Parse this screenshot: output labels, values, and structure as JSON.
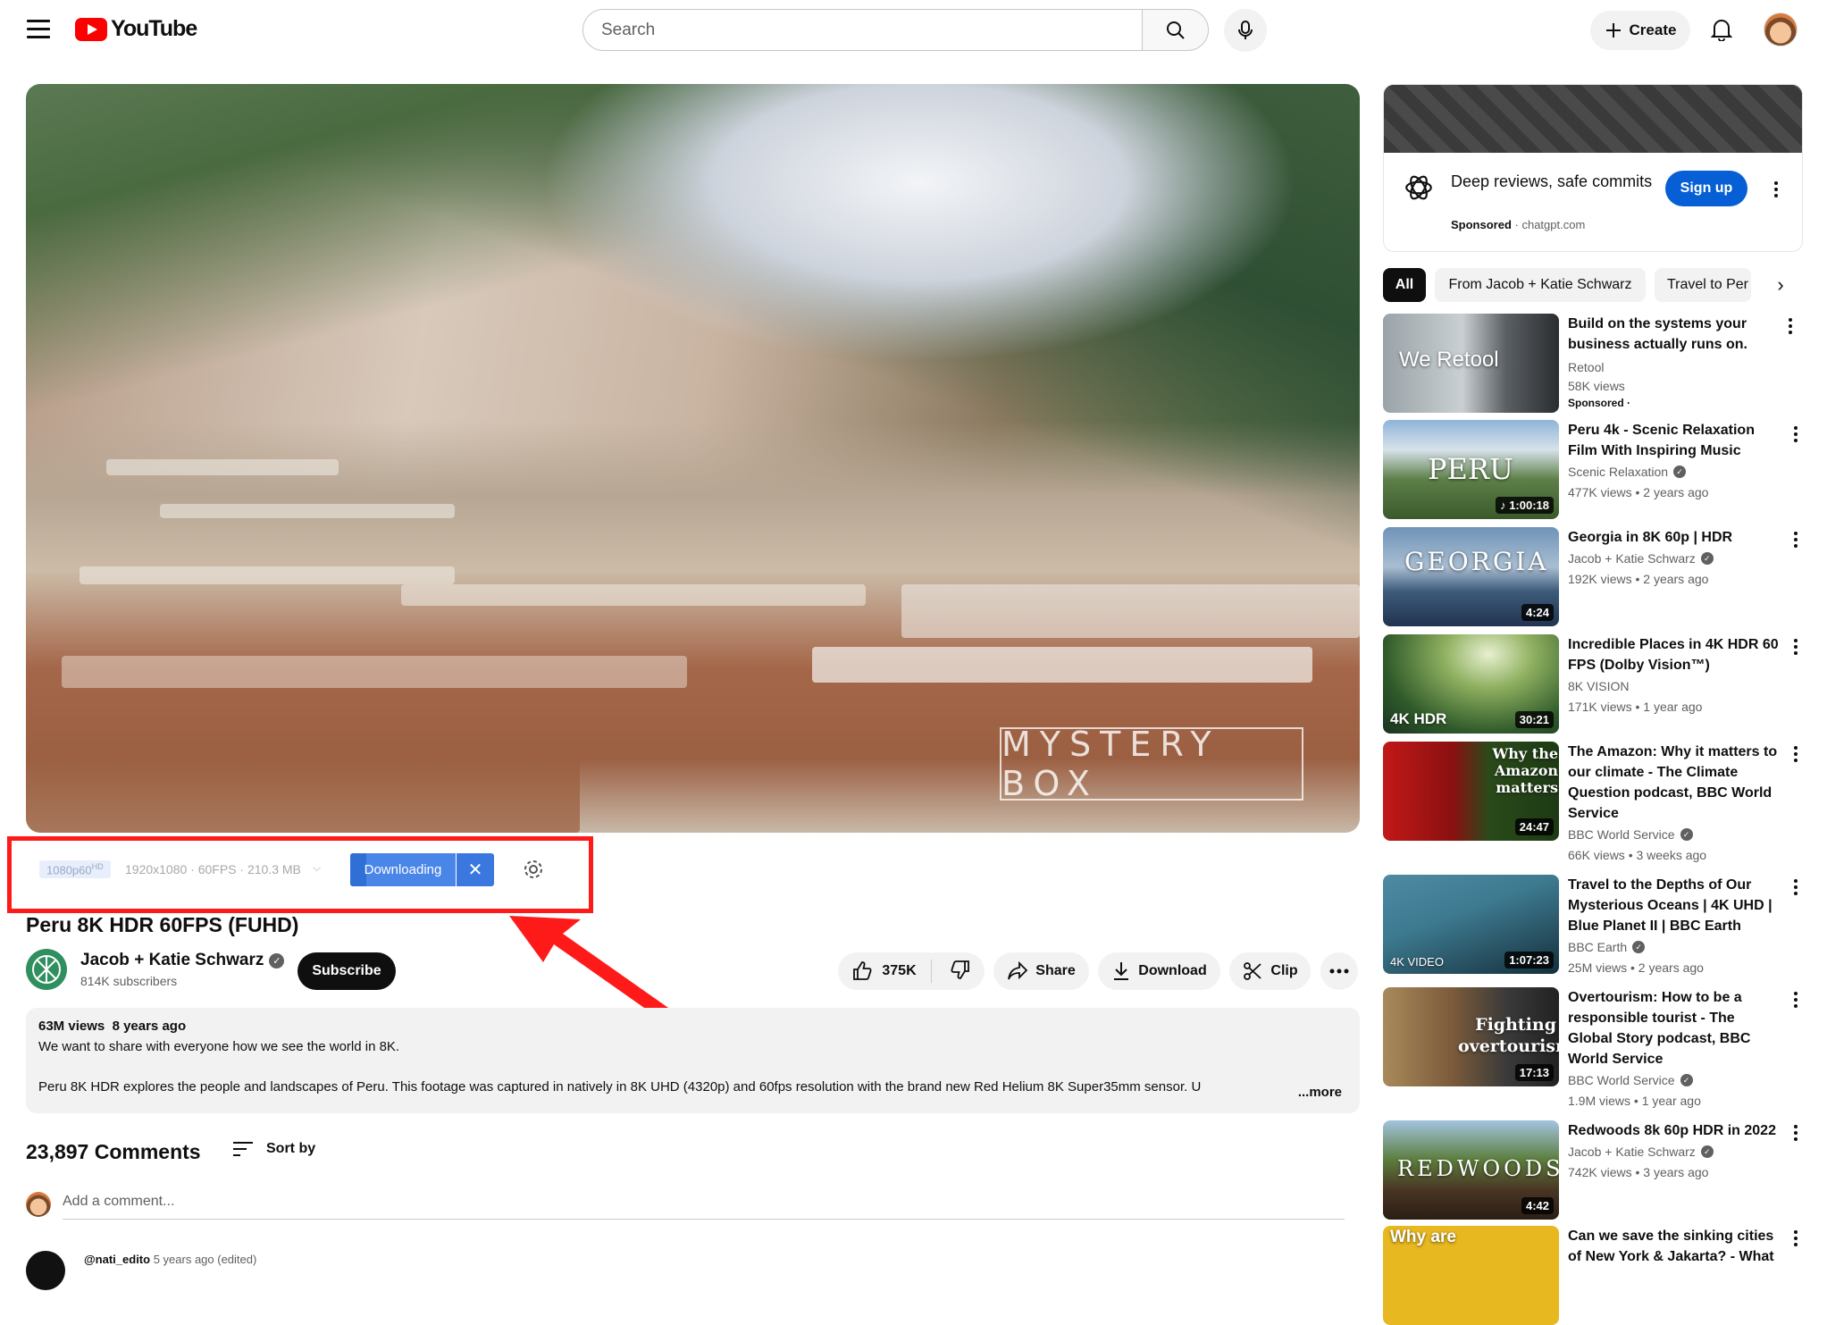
{
  "header": {
    "logo_text": "YouTube",
    "search_placeholder": "Search",
    "create_label": "Create"
  },
  "player": {
    "watermark": "MYSTERY BOX"
  },
  "download_bar": {
    "quality": "1080p60",
    "quality_badge": "HD",
    "resolution_info": "1920x1080 · 60FPS · 210.3 MB",
    "downloading_label": "Downloading",
    "cancel_label": "✕"
  },
  "video": {
    "title": "Peru 8K HDR 60FPS (FUHD)",
    "channel": "Jacob + Katie Schwarz",
    "subscribers": "814K subscribers",
    "subscribe_label": "Subscribe",
    "likes": "375K",
    "share_label": "Share",
    "download_label": "Download",
    "clip_label": "Clip"
  },
  "description": {
    "views": "63M views",
    "age": "8 years ago",
    "line1": "We want to share with everyone how we see the world in 8K.",
    "line2": "Peru 8K HDR explores the people and landscapes of Peru. This footage was captured in natively in 8K UHD (4320p) and 60fps resolution with the brand new Red Helium 8K Super35mm sensor. U",
    "more_label": "...more"
  },
  "comments": {
    "count": "23,897 Comments",
    "sort_label": "Sort by",
    "add_placeholder": "Add a comment...",
    "next_author": "@nati_edito",
    "next_meta": "5 years ago (edited)"
  },
  "ad": {
    "title": "Deep reviews, safe commits",
    "sponsored": "Sponsored",
    "domain": "· chatgpt.com",
    "signup_label": "Sign up"
  },
  "chips": [
    "All",
    "From Jacob + Katie Schwarz",
    "Travel to Per"
  ],
  "recommendations": [
    {
      "title": "Build on the systems your business actually runs on.",
      "channel": "Retool",
      "meta": "58K views",
      "sponsored": "Sponsored ·",
      "overlay": "We Retool",
      "duration": ""
    },
    {
      "title": "Peru 4k - Scenic Relaxation Film With Inspiring Music",
      "channel": "Scenic Relaxation",
      "meta": "477K views • 2 years ago",
      "overlay": "PERU",
      "duration": "♪ 1:00:18"
    },
    {
      "title": "Georgia in 8K 60p | HDR",
      "channel": "Jacob + Katie Schwarz",
      "meta": "192K views • 2 years ago",
      "overlay": "GEORGIA",
      "duration": "4:24"
    },
    {
      "title": "Incredible Places in 4K HDR 60 FPS (Dolby Vision™)",
      "channel": "8K VISION",
      "meta": "171K views • 1 year ago",
      "overlay": "4K HDR",
      "duration": "30:21"
    },
    {
      "title": "The Amazon: Why it matters to our climate - The Climate Question podcast, BBC World Service",
      "channel": "BBC World Service",
      "meta": "66K views • 3 weeks ago",
      "overlay": "Why the Amazon matters",
      "duration": "24:47"
    },
    {
      "title": "Travel to the Depths of Our Mysterious Oceans | 4K UHD | Blue Planet II | BBC Earth",
      "channel": "BBC Earth",
      "meta": "25M views • 2 years ago",
      "overlay": "4K VIDEO",
      "duration": "1:07:23"
    },
    {
      "title": "Overtourism: How to be a responsible tourist - The Global Story podcast, BBC World Service",
      "channel": "BBC World Service",
      "meta": "1.9M views • 1 year ago",
      "overlay": "Fighting overtourism",
      "duration": "17:13"
    },
    {
      "title": "Redwoods 8k 60p HDR in 2022",
      "channel": "Jacob + Katie Schwarz",
      "meta": "742K views • 3 years ago",
      "overlay": "REDWOODS",
      "duration": "4:42"
    },
    {
      "title": "Can we save the sinking cities of New York & Jakarta? - What",
      "channel": "",
      "meta": "",
      "overlay": "Why are",
      "duration": ""
    }
  ]
}
